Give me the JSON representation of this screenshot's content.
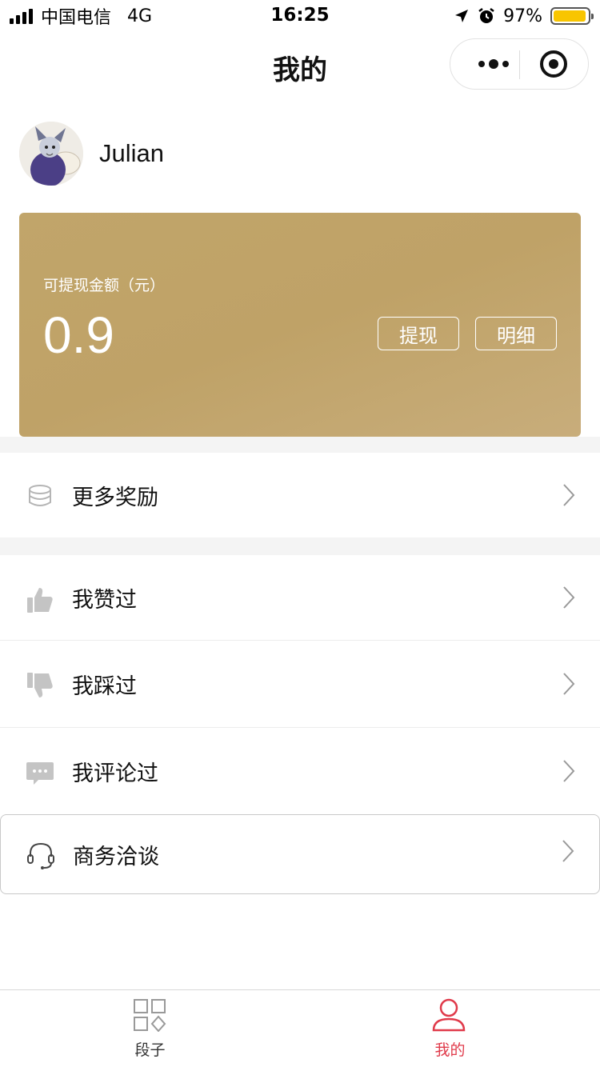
{
  "status_bar": {
    "carrier": "中国电信",
    "network": "4G",
    "time": "16:25",
    "battery": "97%",
    "battery_color": "#f8c500"
  },
  "nav": {
    "title": "我的",
    "more_icon": "more-dots-icon",
    "close_icon": "target-circle-icon"
  },
  "profile": {
    "username": "Julian"
  },
  "balance_card": {
    "label": "可提现金额（元）",
    "amount": "0.9",
    "withdraw_label": "提现",
    "detail_label": "明细",
    "color": "#c1a56a"
  },
  "menu": {
    "rewards": {
      "label": "更多奖励",
      "icon": "coin-stack-icon"
    },
    "liked": {
      "label": "我赞过",
      "icon": "thumbs-up-icon"
    },
    "disliked": {
      "label": "我踩过",
      "icon": "thumbs-down-icon"
    },
    "commented": {
      "label": "我评论过",
      "icon": "comment-icon"
    },
    "business": {
      "label": "商务洽谈",
      "icon": "headset-icon"
    }
  },
  "tabbar": {
    "tabs": [
      {
        "label": "段子",
        "icon": "grid-icon",
        "active": false
      },
      {
        "label": "我的",
        "icon": "user-icon",
        "active": true
      }
    ],
    "active_color": "#e03a4a",
    "inactive_color": "#333333"
  }
}
